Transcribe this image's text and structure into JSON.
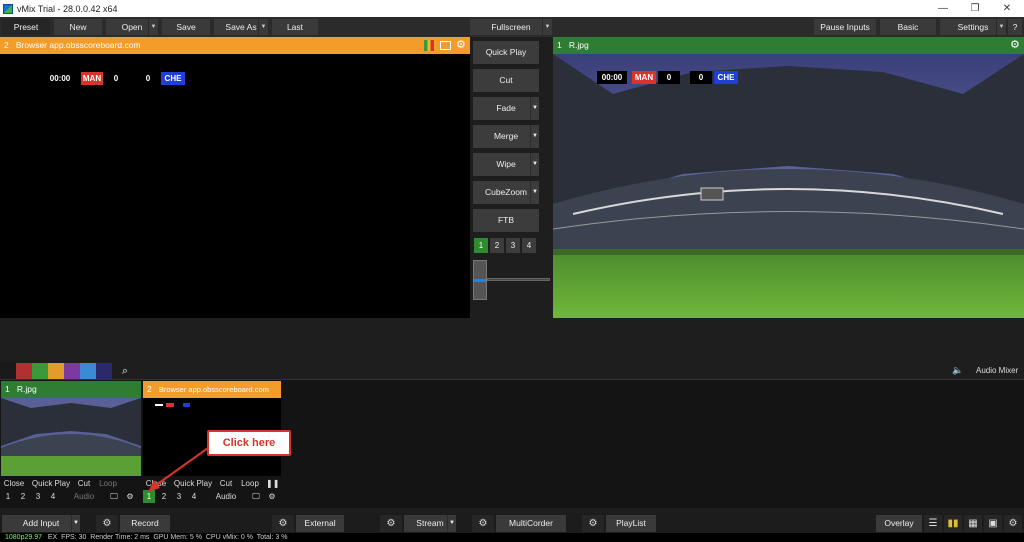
{
  "window": {
    "title": "vMix Trial - 28.0.0.42 x64",
    "min_glyph": "—",
    "max_glyph": "❐",
    "close_glyph": "✕"
  },
  "toolbar": {
    "preset": "Preset",
    "new": "New",
    "open": "Open",
    "save": "Save",
    "save_as": "Save As",
    "last": "Last",
    "fullscreen": "Fullscreen",
    "pause_inputs": "Pause Inputs",
    "basic": "Basic",
    "settings": "Settings",
    "help": "?"
  },
  "preview": {
    "number": "2",
    "title": "Browser app.obsscoreboard.com",
    "scoreboard": {
      "time": "00:00",
      "home_team": "MAN",
      "home_score": "0",
      "away_score": "0",
      "away_team": "CHE"
    }
  },
  "transitions": {
    "quick_play": "Quick Play",
    "cut": "Cut",
    "fade": "Fade",
    "merge": "Merge",
    "wipe": "Wipe",
    "cubezoom": "CubeZoom",
    "ftb": "FTB",
    "numbers": [
      "1",
      "2",
      "3",
      "4"
    ],
    "active_number": "1"
  },
  "output": {
    "number": "1",
    "title": "R.jpg",
    "scoreboard": {
      "time": "00:00",
      "home_team": "MAN",
      "home_score": "0",
      "away_score": "0",
      "away_team": "CHE"
    }
  },
  "color_strip": [
    "#1a1a1a",
    "#b33030",
    "#3a9a3a",
    "#e39b2a",
    "#7a3aa0",
    "#3a8ad6",
    "#2a2a6a"
  ],
  "audio_mixer": {
    "label": "Audio Mixer"
  },
  "inputs": [
    {
      "number": "1",
      "title": "R.jpg",
      "header_color": "#2e7d32",
      "controls": [
        "Close",
        "Quick Play",
        "Cut",
        "Loop"
      ],
      "numbers": [
        "1",
        "2",
        "3",
        "4"
      ],
      "audio": "Audio"
    },
    {
      "number": "2",
      "title": "Browser app.obsscoreboard.com",
      "header_color": "#f39c2a",
      "controls": [
        "Close",
        "Quick Play",
        "Cut",
        "Loop"
      ],
      "numbers": [
        "1",
        "2",
        "3",
        "4"
      ],
      "active_number": "1",
      "audio": "Audio"
    }
  ],
  "callout": {
    "text": "Click here"
  },
  "bottombar": {
    "add_input": "Add Input",
    "record": "Record",
    "external": "External",
    "stream": "Stream",
    "multicorder": "MultiCorder",
    "playlist": "PlayList",
    "overlay": "Overlay"
  },
  "status": {
    "resolution": "1080p29.97",
    "ex": "EX",
    "fps_label": "FPS:",
    "fps": "30",
    "render_label": "Render Time:",
    "render": "2 ms",
    "gpu_label": "GPU Mem:",
    "gpu": "5 %",
    "cpu_label": "CPU vMix:",
    "cpu": "0 %",
    "total_label": "Total:",
    "total": "3 %"
  },
  "colors": {
    "orange": "#f39c2a",
    "green": "#2e7d32",
    "team_red": "#d9342b",
    "team_blue": "#1f3fd6"
  }
}
